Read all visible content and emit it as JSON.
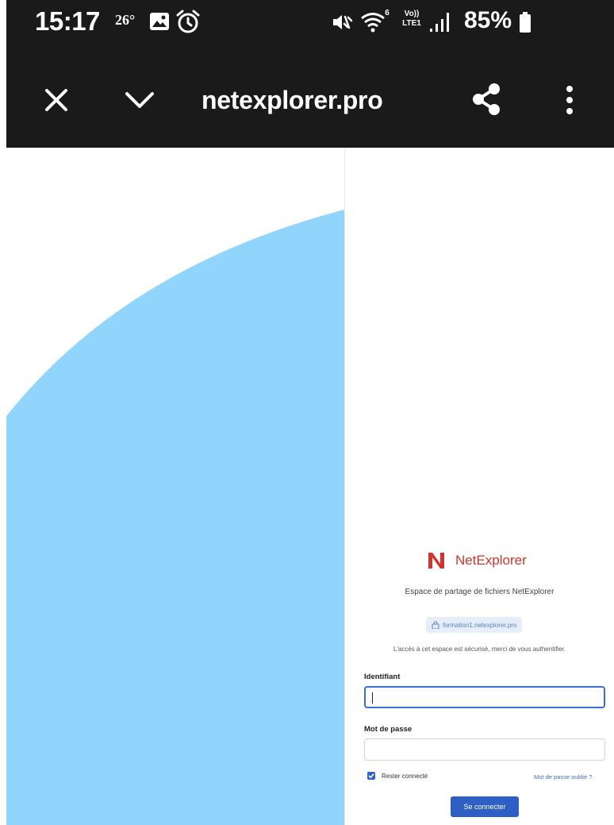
{
  "status_bar": {
    "time": "15:17",
    "temperature": "26°",
    "battery_percent": "85%",
    "volte_label": "Vo))",
    "lte_label": "LTE1",
    "wifi_badge": "6",
    "icons": [
      "gallery-icon",
      "alarm-icon",
      "mute-vibrate-icon",
      "wifi-icon",
      "signal-icon",
      "battery-icon"
    ]
  },
  "toolbar": {
    "url": "netexplorer.pro",
    "icons": [
      "close-icon",
      "chevron-down-icon",
      "share-icon",
      "more-vert-icon"
    ]
  },
  "colors": {
    "chrome_bg": "#1a1a1a",
    "hero_blue": "#92d5fc",
    "brand_red": "#d0342c",
    "primary_blue": "#2f5fc4",
    "focus_blue": "#3b6fd6"
  },
  "login": {
    "brand_name": "NetExplorer",
    "subtitle": "Espace de partage de fichiers NetExplorer",
    "domain": "formation1.netexplorer.pro",
    "notice": "L'accès à cet espace est sécurisé, merci de vous authentifier.",
    "username_label": "Identifiant",
    "username_value": "",
    "password_label": "Mot de passe",
    "password_value": "",
    "remember_label": "Rester connecté",
    "remember_checked": true,
    "forgot_label": "Mot de passe oublié ?",
    "submit_label": "Se connecter"
  }
}
